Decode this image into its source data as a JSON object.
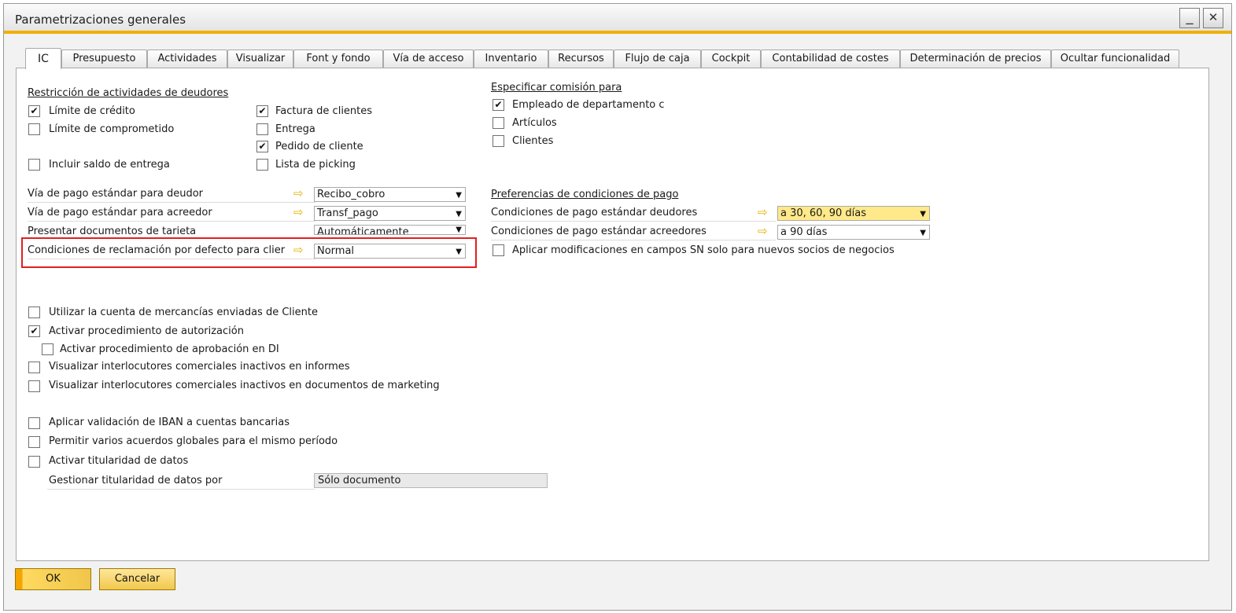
{
  "window": {
    "title": "Parametrizaciones generales",
    "minimize_glyph": "_",
    "close_glyph": "✕"
  },
  "tabs": [
    {
      "label": "IC",
      "active": true
    },
    {
      "label": "Presupuesto"
    },
    {
      "label": "Actividades"
    },
    {
      "label": "Visualizar"
    },
    {
      "label": "Font y fondo"
    },
    {
      "label": "Vía de acceso"
    },
    {
      "label": "Inventario"
    },
    {
      "label": "Recursos"
    },
    {
      "label": "Flujo de caja"
    },
    {
      "label": "Cockpit"
    },
    {
      "label": "Contabilidad de costes"
    },
    {
      "label": "Determinación de precios"
    },
    {
      "label": "Ocultar funcionalidad"
    }
  ],
  "restriccion": {
    "heading": "Restricción de actividades de deudores",
    "limite_credito": {
      "label": "Límite de crédito",
      "checked": true
    },
    "limite_comprometido": {
      "label": "Límite de comprometido",
      "checked": false
    },
    "incluir_saldo": {
      "label": "Incluir saldo de entrega",
      "checked": false
    },
    "factura_clientes": {
      "label": "Factura de clientes",
      "checked": true
    },
    "entrega": {
      "label": "Entrega",
      "checked": false
    },
    "pedido_cliente": {
      "label": "Pedido de cliente",
      "checked": true
    },
    "lista_picking": {
      "label": "Lista de picking",
      "checked": false
    }
  },
  "comision": {
    "heading": "Especificar comisión para",
    "empleado": {
      "label": "Empleado de departamento c",
      "checked": true
    },
    "articulos": {
      "label": "Artículos",
      "checked": false
    },
    "clientes": {
      "label": "Clientes",
      "checked": false
    }
  },
  "fields_left": [
    {
      "label": "Vía de pago estándar para deudor",
      "value": "Recibo_cobro"
    },
    {
      "label": "Vía de pago estándar para acreedor",
      "value": "Transf_pago"
    },
    {
      "label": "Presentar documentos de tarjeta",
      "value": "Automáticamente"
    },
    {
      "label": "Condiciones de reclamación por defecto para clier",
      "value": "Normal"
    }
  ],
  "pago": {
    "heading": "Preferencias de condiciones de pago",
    "deudores": {
      "label": "Condiciones de pago estándar deudores",
      "value": "a 30, 60, 90 días"
    },
    "acreedores": {
      "label": "Condiciones de pago estándar acreedores",
      "value": "a 90 días"
    },
    "aplicar_sn": {
      "label": "Aplicar modificaciones en campos SN solo para nuevos socios de negocios",
      "checked": false
    }
  },
  "options": [
    {
      "label": "Utilizar la cuenta de mercancías enviadas de Cliente",
      "checked": false
    },
    {
      "label": "Activar procedimiento de autorización",
      "checked": true
    },
    {
      "label": "Activar procedimiento de aprobación en DI",
      "checked": false
    },
    {
      "label": "Visualizar interlocutores comerciales inactivos en informes",
      "checked": false
    },
    {
      "label": "Visualizar interlocutores comerciales inactivos en documentos de marketing",
      "checked": false
    },
    {
      "label": "Aplicar validación de IBAN a cuentas bancarias",
      "checked": false
    },
    {
      "label": "Permitir varios acuerdos globales para el mismo período",
      "checked": false
    },
    {
      "label": "Activar titularidad de datos",
      "checked": false
    }
  ],
  "titularidad": {
    "label": "Gestionar titularidad de datos por",
    "value": "Sólo documento"
  },
  "buttons": {
    "ok": "OK",
    "cancel": "Cancelar"
  },
  "glyphs": {
    "check": "✔",
    "link_arrow": "⇨",
    "dropdown": "▼"
  },
  "colors": {
    "accent": "#f0b000",
    "highlight_border": "#e0201f",
    "select_highlight": "#ffe98a"
  }
}
